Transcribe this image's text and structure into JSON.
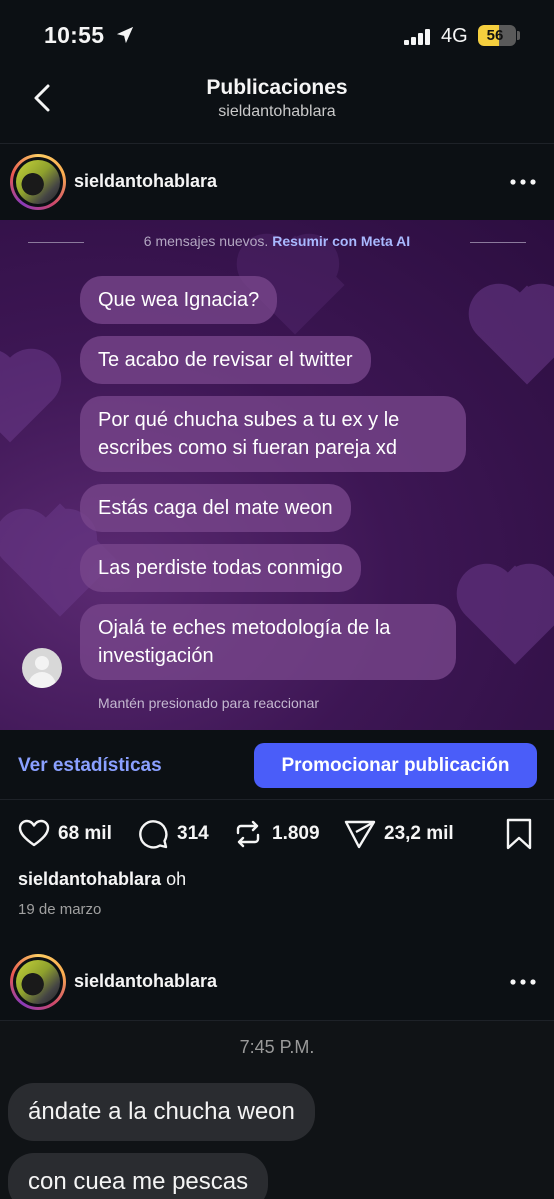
{
  "status_bar": {
    "time": "10:55",
    "network": "4G",
    "battery": "56",
    "battery_level": 0.56,
    "icons": [
      "location-arrow-icon",
      "signal-icon",
      "battery-icon"
    ]
  },
  "header": {
    "title": "Publicaciones",
    "subtitle": "sieldantohablara"
  },
  "post": {
    "username": "sieldantohablara",
    "dm": {
      "new_messages": "6 mensajes nuevos.",
      "summarize_link": "Resumir con Meta AI",
      "messages": [
        "Que wea Ignacia?",
        "Te acabo de revisar el twitter",
        "Por qué chucha subes a tu ex y le escribes como si fueran pareja xd",
        "Estás caga del mate weon",
        "Las perdiste todas conmigo",
        "Ojalá te eches metodología de la investigación"
      ],
      "hold_hint": "Mantén presionado para reaccionar"
    },
    "stats_link": "Ver estadísticas",
    "promote_button": "Promocionar publicación",
    "likes": "68 mil",
    "comments": "314",
    "reposts": "1.809",
    "shares": "23,2 mil",
    "caption_user": "sieldantohablara",
    "caption_text": "oh",
    "date": "19 de marzo"
  },
  "post2": {
    "username": "sieldantohablara",
    "chat_time": "7:45 P.M.",
    "messages": [
      "ándate a la chucha weon",
      "con cuea me pescas"
    ]
  },
  "colors": {
    "background": "#0c1014",
    "accent_blue": "#4a5df9",
    "link_blue": "#8aa0ff",
    "battery_yellow": "#f5cf3e",
    "dm_purple": "#3d1654"
  }
}
